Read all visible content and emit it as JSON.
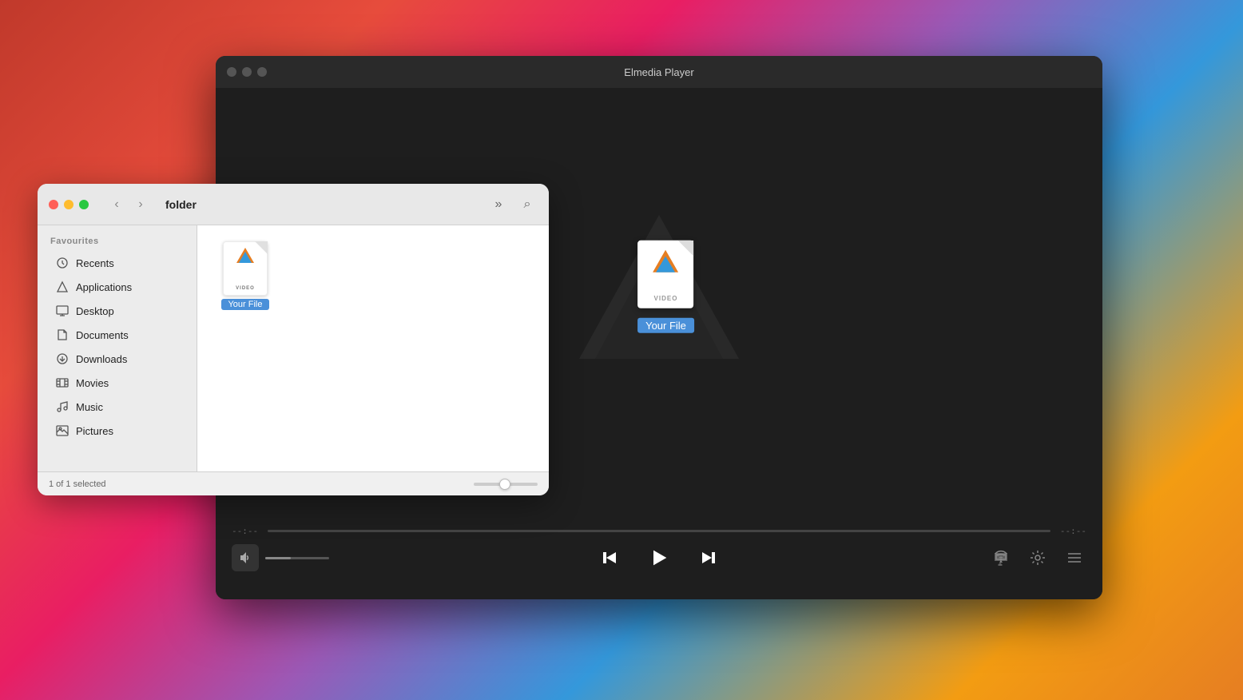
{
  "desktop": {
    "bg": "macOS desktop background"
  },
  "player": {
    "title": "Elmedia Player",
    "traffic_lights": {
      "close": "close",
      "minimize": "minimize",
      "maximize": "maximize"
    },
    "file_icon": {
      "label": "VIDEO",
      "name": "Your File"
    },
    "controls": {
      "time_start": "--:--",
      "time_end": "--:--",
      "prev_label": "⏮",
      "play_label": "▶",
      "next_label": "⏭",
      "airplay_label": "airplay",
      "settings_label": "settings",
      "playlist_label": "playlist"
    }
  },
  "finder": {
    "title": "folder",
    "sidebar": {
      "section_label": "Favourites",
      "items": [
        {
          "label": "Recents",
          "icon": "🕐"
        },
        {
          "label": "Applications",
          "icon": "🚀"
        },
        {
          "label": "Desktop",
          "icon": "🖥"
        },
        {
          "label": "Documents",
          "icon": "📄"
        },
        {
          "label": "Downloads",
          "icon": "⬇"
        },
        {
          "label": "Movies",
          "icon": "🎬"
        },
        {
          "label": "Music",
          "icon": "🎵"
        },
        {
          "label": "Pictures",
          "icon": "🖼"
        }
      ]
    },
    "file": {
      "label": "VIDEO",
      "name": "Your File"
    },
    "status": {
      "text": "1 of 1 selected"
    }
  }
}
